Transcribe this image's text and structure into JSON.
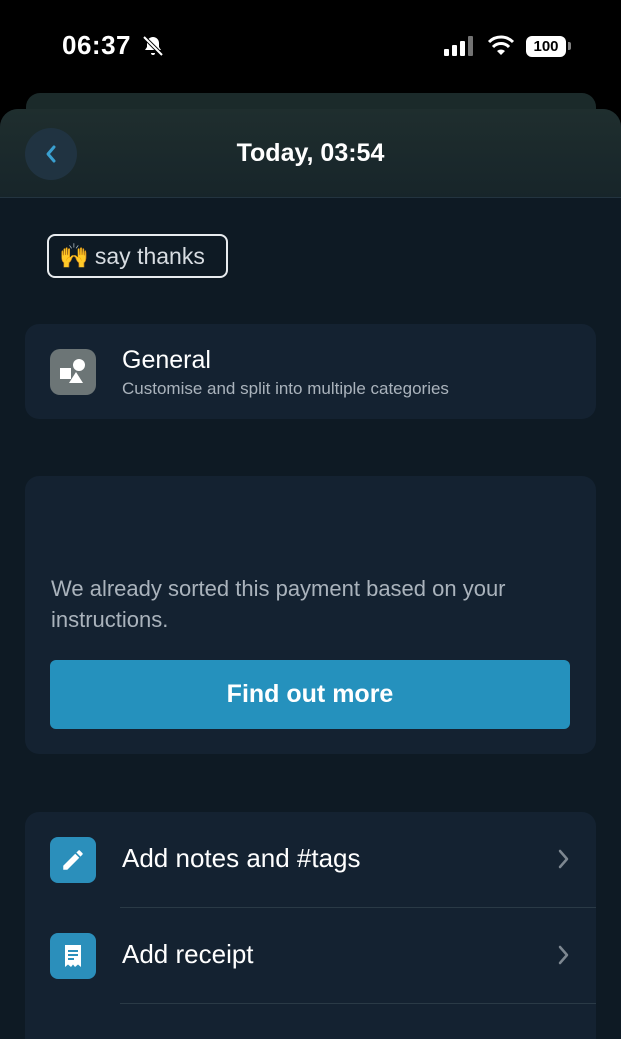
{
  "status_bar": {
    "time": "06:37",
    "battery": "100"
  },
  "header": {
    "title": "Today, 03:54"
  },
  "thanks": {
    "emoji": "🙌",
    "label": "say thanks"
  },
  "category": {
    "name": "General",
    "subtitle": "Customise and split into multiple categories"
  },
  "info": {
    "text": "We already sorted this payment based on your instructions.",
    "button_label": "Find out more"
  },
  "actions": [
    {
      "label": "Add notes and #tags",
      "icon": "pencil-icon"
    },
    {
      "label": "Add receipt",
      "icon": "receipt-icon"
    }
  ],
  "colors": {
    "accent": "#2591bd",
    "background": "#0e1a24",
    "card": "#142231"
  }
}
